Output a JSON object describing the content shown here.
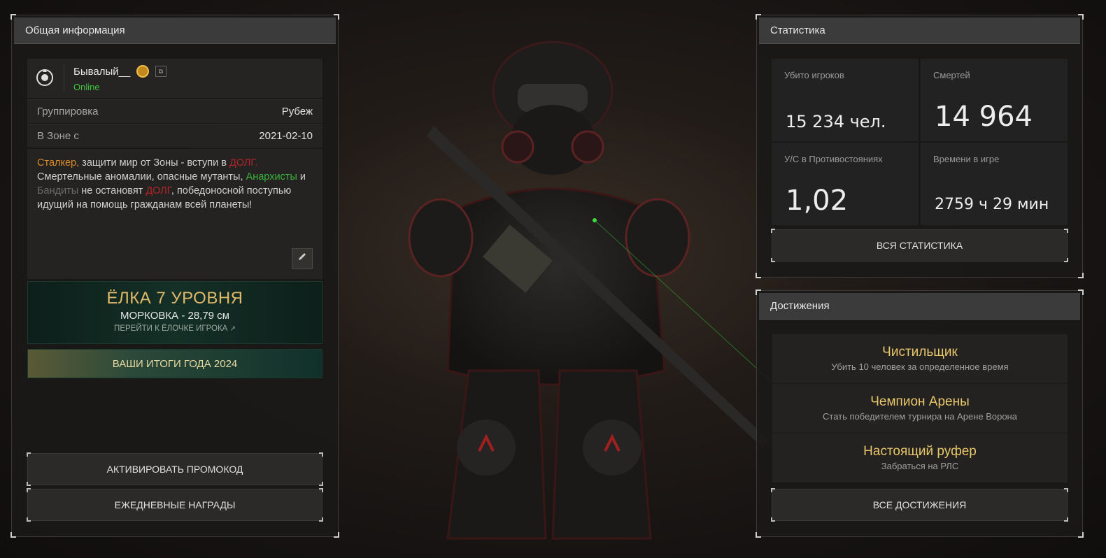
{
  "info_panel": {
    "title": "Общая информация",
    "player": {
      "name": "Бывалый__",
      "status": "Online"
    },
    "rows": [
      {
        "key": "Группировка",
        "value": "Рубеж"
      },
      {
        "key": "В Зоне с",
        "value": "2021-02-10"
      }
    ],
    "bio": {
      "p1": "Сталкер,",
      "p2": " защити мир от Зоны - вступи в ",
      "p3": "ДОЛГ.",
      "p4": " Смертельные аномалии, опасные мутанты, ",
      "p5": "Анархисты",
      "p6": " и ",
      "p7": "Бандиты",
      "p8": " не остановят ",
      "p9": "ДОЛГ",
      "p10": ", победоносной поступью идущий на помощь гражданам всей планеты!"
    },
    "tree_banner": {
      "title": "ЁЛКА 7 УРОВНЯ",
      "subtitle": "МОРКОВКА - 28,79 см",
      "link": "ПЕРЕЙТИ К ЁЛОЧКЕ ИГРОКА"
    },
    "year_banner": "ВАШИ ИТОГИ ГОДА 2024",
    "buttons": {
      "promo": "АКТИВИРОВАТЬ ПРОМОКОД",
      "daily": "ЕЖЕДНЕВНЫЕ НАГРАДЫ"
    }
  },
  "stats_panel": {
    "title": "Статистика",
    "items": [
      {
        "label": "Убито игроков",
        "value": "15 234 чел."
      },
      {
        "label": "Смертей",
        "value": "14 964"
      },
      {
        "label": "У/С в Противостояниях",
        "value": "1,02"
      },
      {
        "label": "Времени в игре",
        "value": "2759 ч 29 мин"
      }
    ],
    "button": "ВСЯ СТАТИСТИКА"
  },
  "achievements_panel": {
    "title": "Достижения",
    "items": [
      {
        "title": "Чистильщик",
        "desc": "Убить 10 человек за определенное время"
      },
      {
        "title": "Чемпион Арены",
        "desc": "Стать победителем турнира на Арене Ворона"
      },
      {
        "title": "Настоящий руфер",
        "desc": "Забраться на РЛС"
      }
    ],
    "button": "ВСЕ ДОСТИЖЕНИЯ"
  },
  "colors": {
    "online": "#3fc43f",
    "orange": "#d98a2b",
    "red": "#b0252a",
    "green": "#3bb33b",
    "gray": "#6b6b6b",
    "gold": "#e8c66a"
  }
}
